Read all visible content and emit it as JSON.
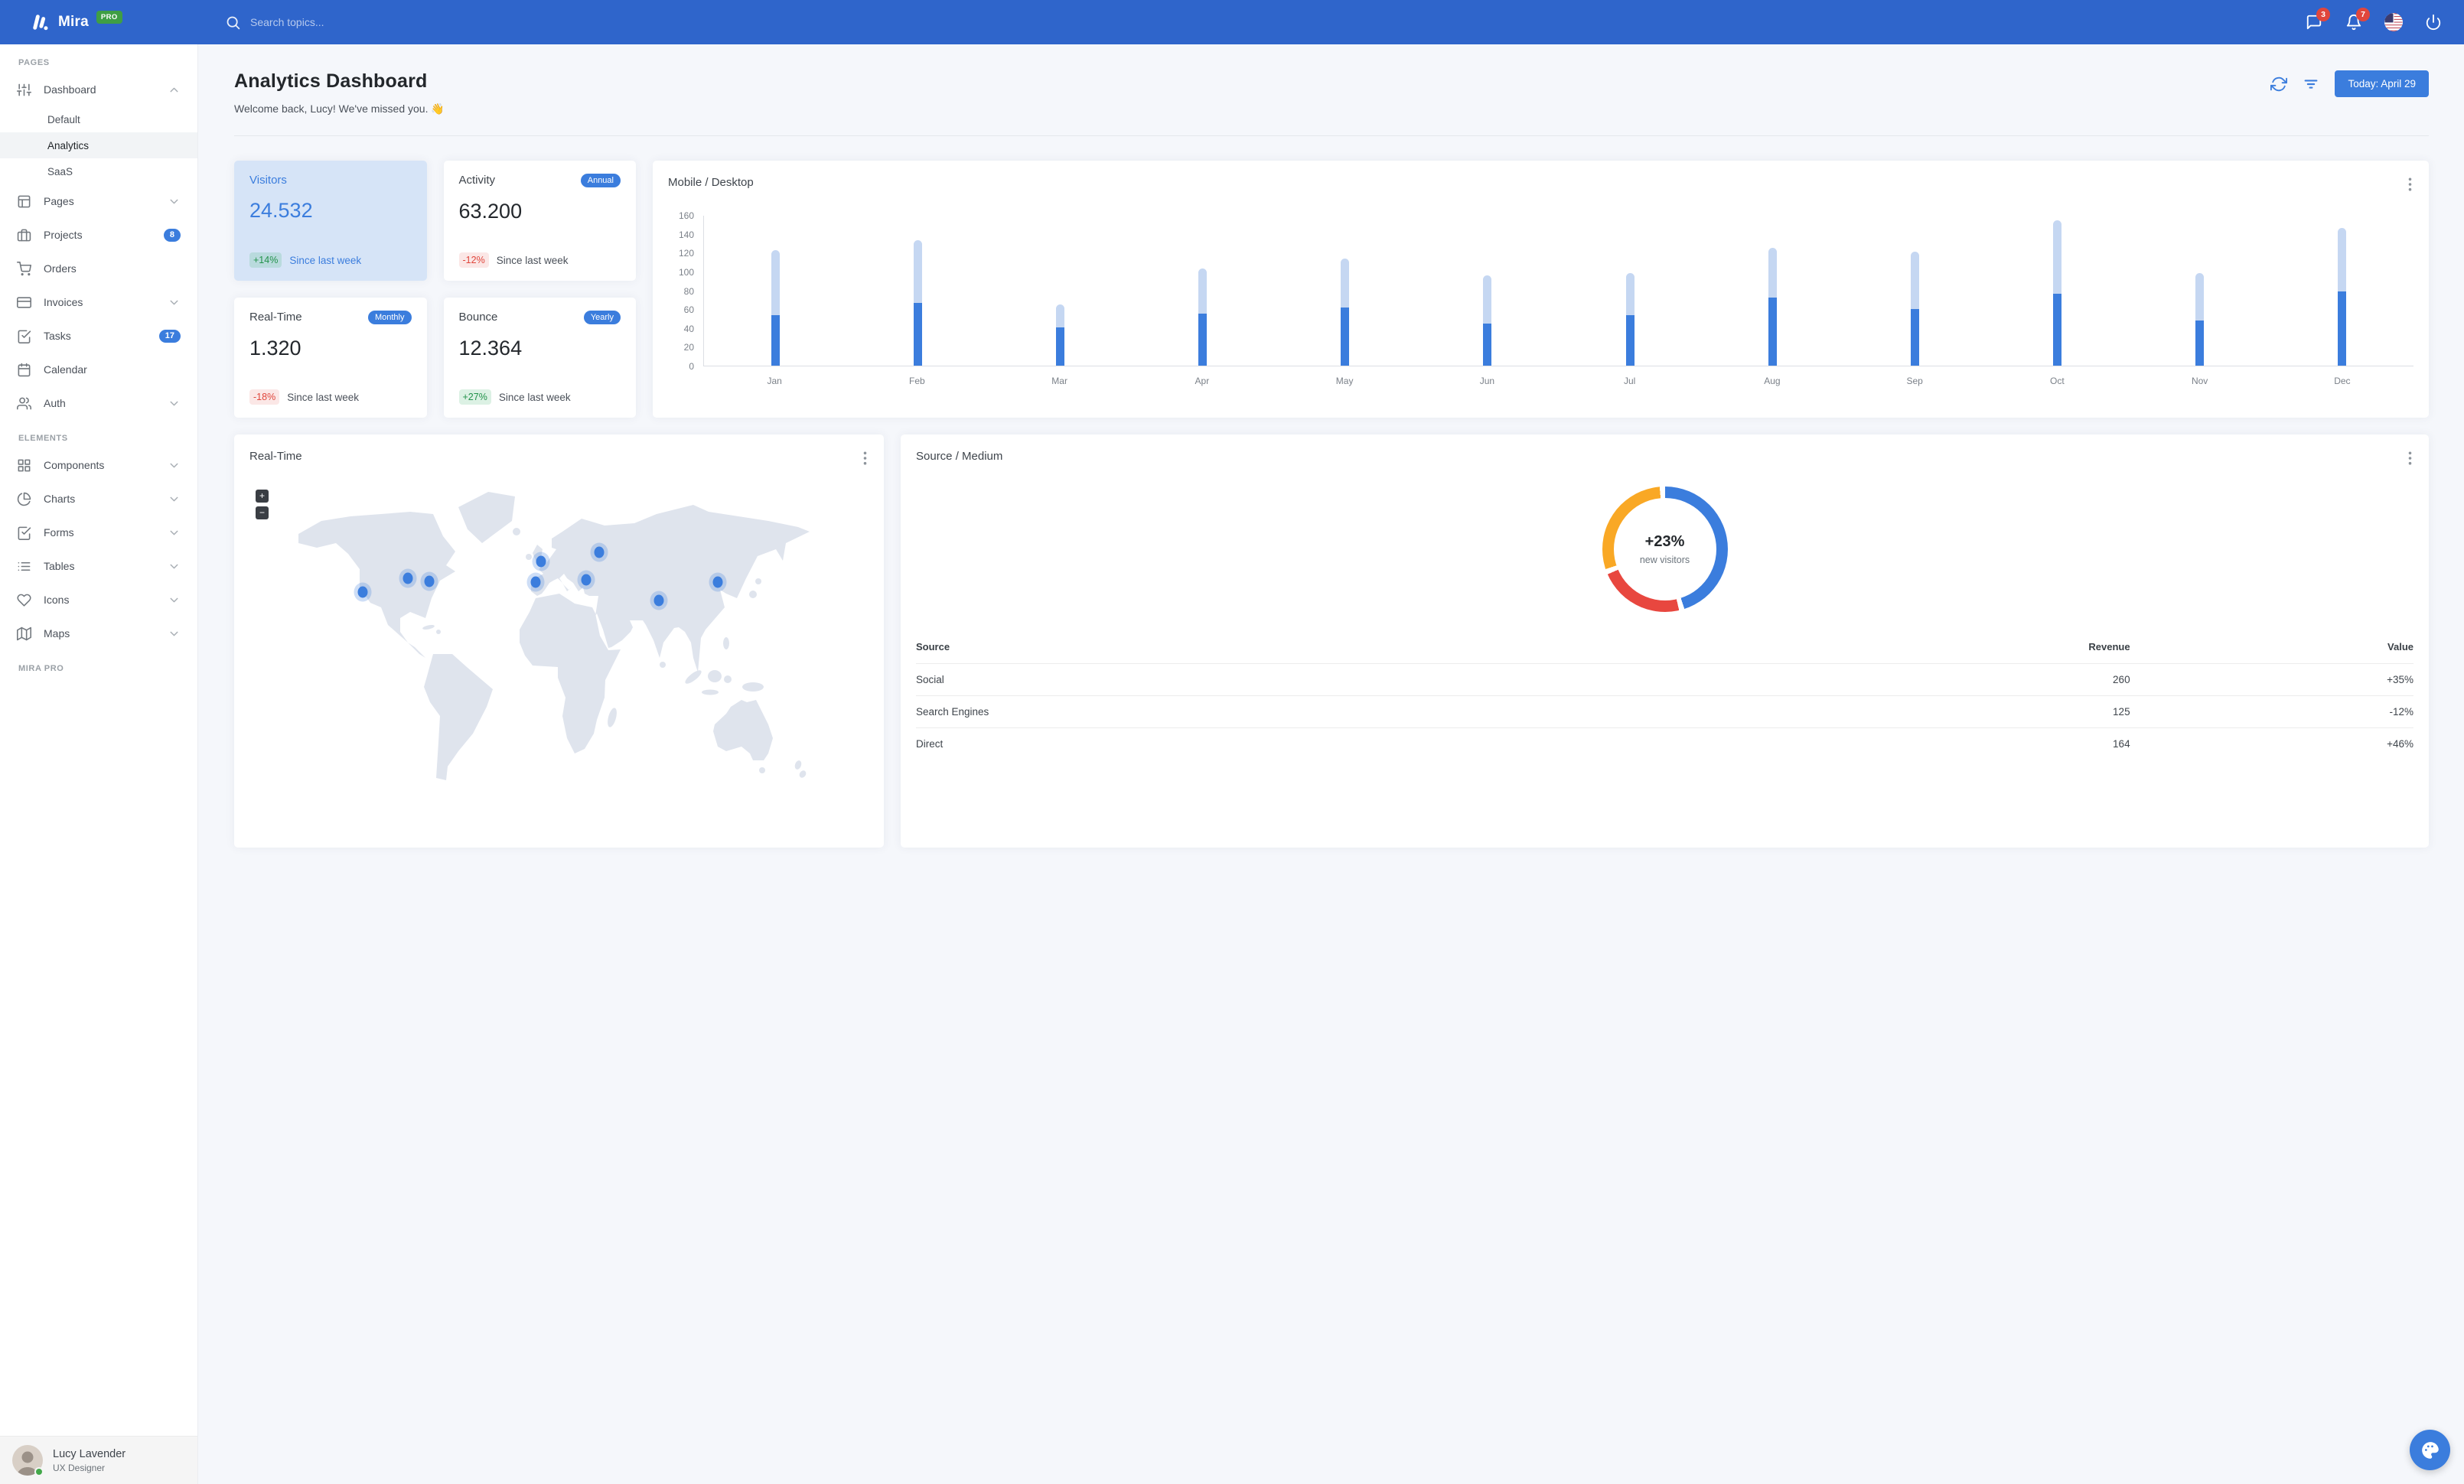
{
  "colors": {
    "navbar": "#2F65CB",
    "primary": "#3B7DDD",
    "bar_mobile": "#3B7DDD",
    "bar_desktop": "#C5D7F2",
    "success": "#28A558",
    "danger": "#E0463C",
    "donut_blue": "#3B7DDD",
    "donut_red": "#E8473F",
    "donut_orange": "#F9A825",
    "pro_badge_green": "#3F9E44"
  },
  "navbar": {
    "brand": "Mira",
    "brand_badge": "PRO",
    "search_placeholder": "Search topics...",
    "messages_badge": "3",
    "notifications_badge": "7"
  },
  "sidebar": {
    "sections": [
      {
        "label": "PAGES",
        "items": [
          {
            "label": "Dashboard",
            "icon": "sliders-icon",
            "chevron": "up",
            "children": [
              {
                "label": "Default",
                "active": false
              },
              {
                "label": "Analytics",
                "active": true
              },
              {
                "label": "SaaS",
                "active": false
              }
            ]
          },
          {
            "label": "Pages",
            "icon": "layout-icon",
            "chevron": "down"
          },
          {
            "label": "Projects",
            "icon": "briefcase-icon",
            "badge": "8"
          },
          {
            "label": "Orders",
            "icon": "cart-icon"
          },
          {
            "label": "Invoices",
            "icon": "credit-card-icon",
            "chevron": "down"
          },
          {
            "label": "Tasks",
            "icon": "check-square-icon",
            "badge": "17"
          },
          {
            "label": "Calendar",
            "icon": "calendar-icon"
          },
          {
            "label": "Auth",
            "icon": "users-icon",
            "chevron": "down"
          }
        ]
      },
      {
        "label": "ELEMENTS",
        "items": [
          {
            "label": "Components",
            "icon": "grid-icon",
            "chevron": "down"
          },
          {
            "label": "Charts",
            "icon": "pie-chart-icon",
            "chevron": "down"
          },
          {
            "label": "Forms",
            "icon": "check-square-icon",
            "chevron": "down"
          },
          {
            "label": "Tables",
            "icon": "list-icon",
            "chevron": "down"
          },
          {
            "label": "Icons",
            "icon": "heart-icon",
            "chevron": "down"
          },
          {
            "label": "Maps",
            "icon": "map-icon",
            "chevron": "down"
          }
        ]
      },
      {
        "label": "MIRA PRO",
        "items": []
      }
    ],
    "user": {
      "name": "Lucy Lavender",
      "role": "UX Designer",
      "status": "online"
    }
  },
  "header": {
    "title": "Analytics Dashboard",
    "subtitle": "Welcome back, Lucy! We've missed you. 👋",
    "today_button": "Today: April 29"
  },
  "stats": [
    {
      "title": "Visitors",
      "value": "24.532",
      "delta": "+14%",
      "delta_type": "positive",
      "caption": "Since last week",
      "variant": "primary"
    },
    {
      "title": "Activity",
      "value": "63.200",
      "delta": "-12%",
      "delta_type": "negative",
      "caption": "Since last week",
      "tag": "Annual"
    },
    {
      "title": "Real-Time",
      "value": "1.320",
      "delta": "-18%",
      "delta_type": "negative",
      "caption": "Since last week",
      "tag": "Monthly"
    },
    {
      "title": "Bounce",
      "value": "12.364",
      "delta": "+27%",
      "delta_type": "positive",
      "caption": "Since last week",
      "tag": "Yearly"
    }
  ],
  "chart_data": [
    {
      "type": "bar",
      "stacked": true,
      "title": "Mobile / Desktop",
      "categories": [
        "Jan",
        "Feb",
        "Mar",
        "Apr",
        "May",
        "Jun",
        "Jul",
        "Aug",
        "Sep",
        "Oct",
        "Nov",
        "Dec"
      ],
      "series": [
        {
          "name": "Mobile",
          "values": [
            54,
            67,
            41,
            55,
            62,
            45,
            54,
            72,
            60,
            76,
            48,
            79
          ]
        },
        {
          "name": "Desktop",
          "values": [
            69,
            66,
            24,
            48,
            52,
            51,
            44,
            53,
            61,
            78,
            50,
            67
          ]
        }
      ],
      "ylim": [
        0,
        160
      ],
      "yticks": [
        160,
        140,
        120,
        100,
        80,
        60,
        40,
        20,
        0
      ],
      "grid": false,
      "legend": "none"
    },
    {
      "type": "pie",
      "subtype": "donut",
      "title": "Source / Medium",
      "center_label": "+23%",
      "center_sublabel": "new visitors",
      "segments": [
        {
          "name": "blue",
          "value": 47
        },
        {
          "name": "red",
          "value": 23
        },
        {
          "name": "orange",
          "value": 30
        }
      ]
    },
    {
      "type": "table",
      "title": "Source / Medium",
      "columns": [
        "Source",
        "Revenue",
        "Value"
      ],
      "rows": [
        {
          "source": "Social",
          "revenue": "260",
          "value": "+35%",
          "value_type": "positive"
        },
        {
          "source": "Search Engines",
          "revenue": "125",
          "value": "-12%",
          "value_type": "negative"
        },
        {
          "source": "Direct",
          "revenue": "164",
          "value": "+46%",
          "value_type": "positive"
        }
      ]
    }
  ],
  "map_card": {
    "title": "Real-Time",
    "zoom_in": "+",
    "zoom_out": "−",
    "markers": [
      {
        "x": 19.8,
        "y": 29.6
      },
      {
        "x": 26.7,
        "y": 26.0
      },
      {
        "x": 30.0,
        "y": 26.8
      },
      {
        "x": 47.2,
        "y": 21.6
      },
      {
        "x": 46.4,
        "y": 27.0
      },
      {
        "x": 54.2,
        "y": 26.4
      },
      {
        "x": 56.2,
        "y": 19.2
      },
      {
        "x": 65.4,
        "y": 31.8
      },
      {
        "x": 74.4,
        "y": 27.0
      }
    ]
  },
  "source_card": {
    "title": "Source / Medium"
  }
}
